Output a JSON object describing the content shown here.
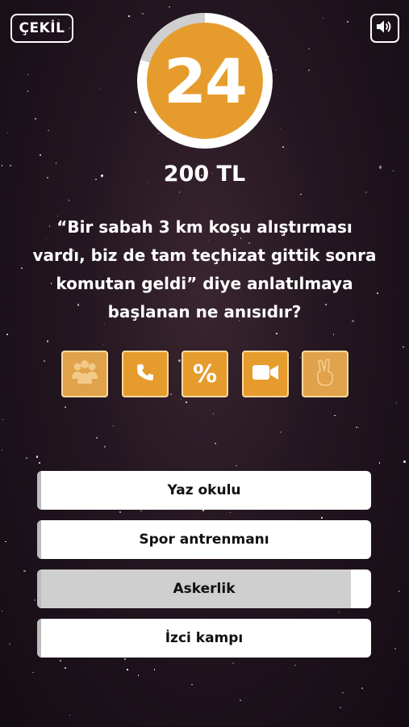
{
  "header": {
    "quit_label": "ÇEKİL",
    "sound_icon": "speaker-icon"
  },
  "timer": {
    "seconds": "24",
    "remaining_fraction": 0.8,
    "accent_color": "#e69c2c"
  },
  "prize": {
    "amount": "200 TL"
  },
  "question": {
    "text": "“Bir sabah 3 km koşu alıştırması vardı, biz de tam teçhizat gittik sonra komutan geldi” diye anlatılmaya başlanan ne anısıdır?"
  },
  "jokers": [
    {
      "icon": "audience-icon",
      "label": ""
    },
    {
      "icon": "phone-icon",
      "label": ""
    },
    {
      "icon": "percent-icon",
      "label": "%"
    },
    {
      "icon": "video-camera-icon",
      "label": ""
    },
    {
      "icon": "victory-hand-icon",
      "label": ""
    }
  ],
  "answers": [
    {
      "label": "Yaz okulu",
      "fill": 0.0
    },
    {
      "label": "Spor antrenmanı",
      "fill": 0.0
    },
    {
      "label": "Askerlik",
      "fill": 0.94
    },
    {
      "label": "İzci kampı",
      "fill": 0.0
    }
  ]
}
